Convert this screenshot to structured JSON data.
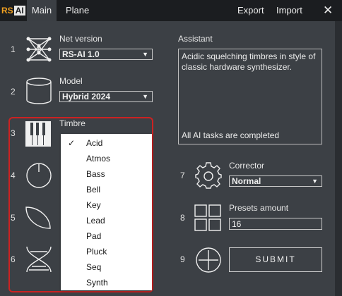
{
  "logo": {
    "rs": "RS",
    "ai": "AI"
  },
  "tabs": [
    {
      "label": "Main",
      "active": true
    },
    {
      "label": "Plane",
      "active": false
    }
  ],
  "menu": {
    "export": "Export",
    "import": "Import"
  },
  "rows": [
    {
      "num": "1",
      "label": "Net version",
      "value": "RS-AI 1.0",
      "icon": "network-icon"
    },
    {
      "num": "2",
      "label": "Model",
      "value": "Hybrid 2024",
      "icon": "cylinder-icon"
    },
    {
      "num": "3",
      "label": "Timbre",
      "icon": "piano-icon"
    },
    {
      "num": "4",
      "icon": "knob-icon"
    },
    {
      "num": "5",
      "icon": "leaf-icon"
    },
    {
      "num": "6",
      "icon": "dna-icon"
    },
    {
      "num": "7",
      "label": "Corrector",
      "value": "Normal",
      "icon": "gear-icon"
    },
    {
      "num": "8",
      "label": "Presets amount",
      "value": "16",
      "icon": "grid-icon"
    },
    {
      "num": "9",
      "icon": "plus-circle-icon"
    }
  ],
  "assistant": {
    "label": "Assistant",
    "text": "Acidic squelching timbres in style of classic hardware synthesizer.",
    "status": "All AI tasks are completed"
  },
  "submit": "SUBMIT",
  "timbre_options": [
    {
      "label": "Acid",
      "checked": true
    },
    {
      "label": "Atmos"
    },
    {
      "label": "Bass"
    },
    {
      "label": "Bell"
    },
    {
      "label": "Key"
    },
    {
      "label": "Lead"
    },
    {
      "label": "Pad"
    },
    {
      "label": "Pluck"
    },
    {
      "label": "Seq"
    },
    {
      "label": "Synth"
    }
  ],
  "check_glyph": "✓",
  "close_glyph": "✕",
  "arrow_glyph": "▼",
  "colors": {
    "accent_logo": "#f0a020",
    "highlight": "#cc2222"
  }
}
